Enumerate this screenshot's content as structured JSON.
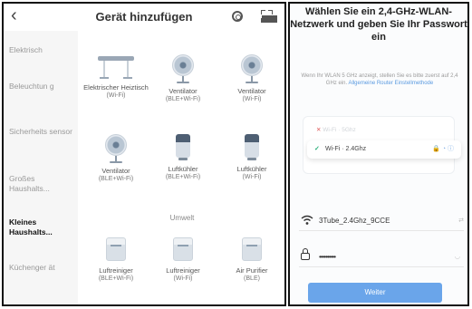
{
  "left": {
    "header": {
      "back_icon": "‹",
      "title": "Gerät hinzufügen"
    },
    "sidebar": [
      {
        "label": "Elektrisch",
        "active": false
      },
      {
        "label": "Beleuchtun g",
        "active": false
      },
      {
        "label": "Sicherheits sensor",
        "active": false
      },
      {
        "label": "Großes Haushalts...",
        "active": false
      },
      {
        "label": "Kleines Haushalts...",
        "active": true
      },
      {
        "label": "Küchenger ät",
        "active": false
      }
    ],
    "devices": [
      {
        "name": "Elektrischer Heiztisch",
        "conn": "(Wi-Fi)",
        "icon": "heater-icon"
      },
      {
        "name": "Ventilator",
        "conn": "(BLE+Wi-Fi)",
        "icon": "fan-icon"
      },
      {
        "name": "Ventilator",
        "conn": "(Wi-Fi)",
        "icon": "fan-icon"
      },
      {
        "name": "Ventilator",
        "conn": "(BLE+Wi-Fi)",
        "icon": "fan-icon"
      },
      {
        "name": "Luftkühler",
        "conn": "(BLE+Wi-Fi)",
        "icon": "air-cooler-icon"
      },
      {
        "name": "Luftkühler",
        "conn": "(Wi-Fi)",
        "icon": "air-cooler-icon"
      },
      {
        "name": "Luftreiniger",
        "conn": "(BLE+Wi-Fi)",
        "icon": "air-purifier-icon"
      },
      {
        "name": "Luftreiniger",
        "conn": "(Wi-Fi)",
        "icon": "air-purifier-icon"
      },
      {
        "name": "Air Purifier",
        "conn": "(BLE)",
        "icon": "air-purifier-icon"
      }
    ],
    "section_label": "Umwelt"
  },
  "right": {
    "title": "Wählen Sie ein 2,4-GHz-WLAN-Netzwerk und geben Sie Ihr Passwort ein",
    "desc": "Wenn Ihr WLAN 5 GHz anzeigt, stellen Sie es bitte zuerst auf 2,4 GHz ein.",
    "link": "Allgemeine Router Einstellmethode",
    "wifi_5g": "Wi-Fi · 5Ghz",
    "wifi_24g": "Wi-Fi · 2.4Ghz",
    "network_name": "3Tube_2.4Ghz_9CCE",
    "password_mask": "••••••••••",
    "button": "Weiter",
    "colors": {
      "accent": "#6aa5ea",
      "check": "#2ab07a"
    }
  }
}
